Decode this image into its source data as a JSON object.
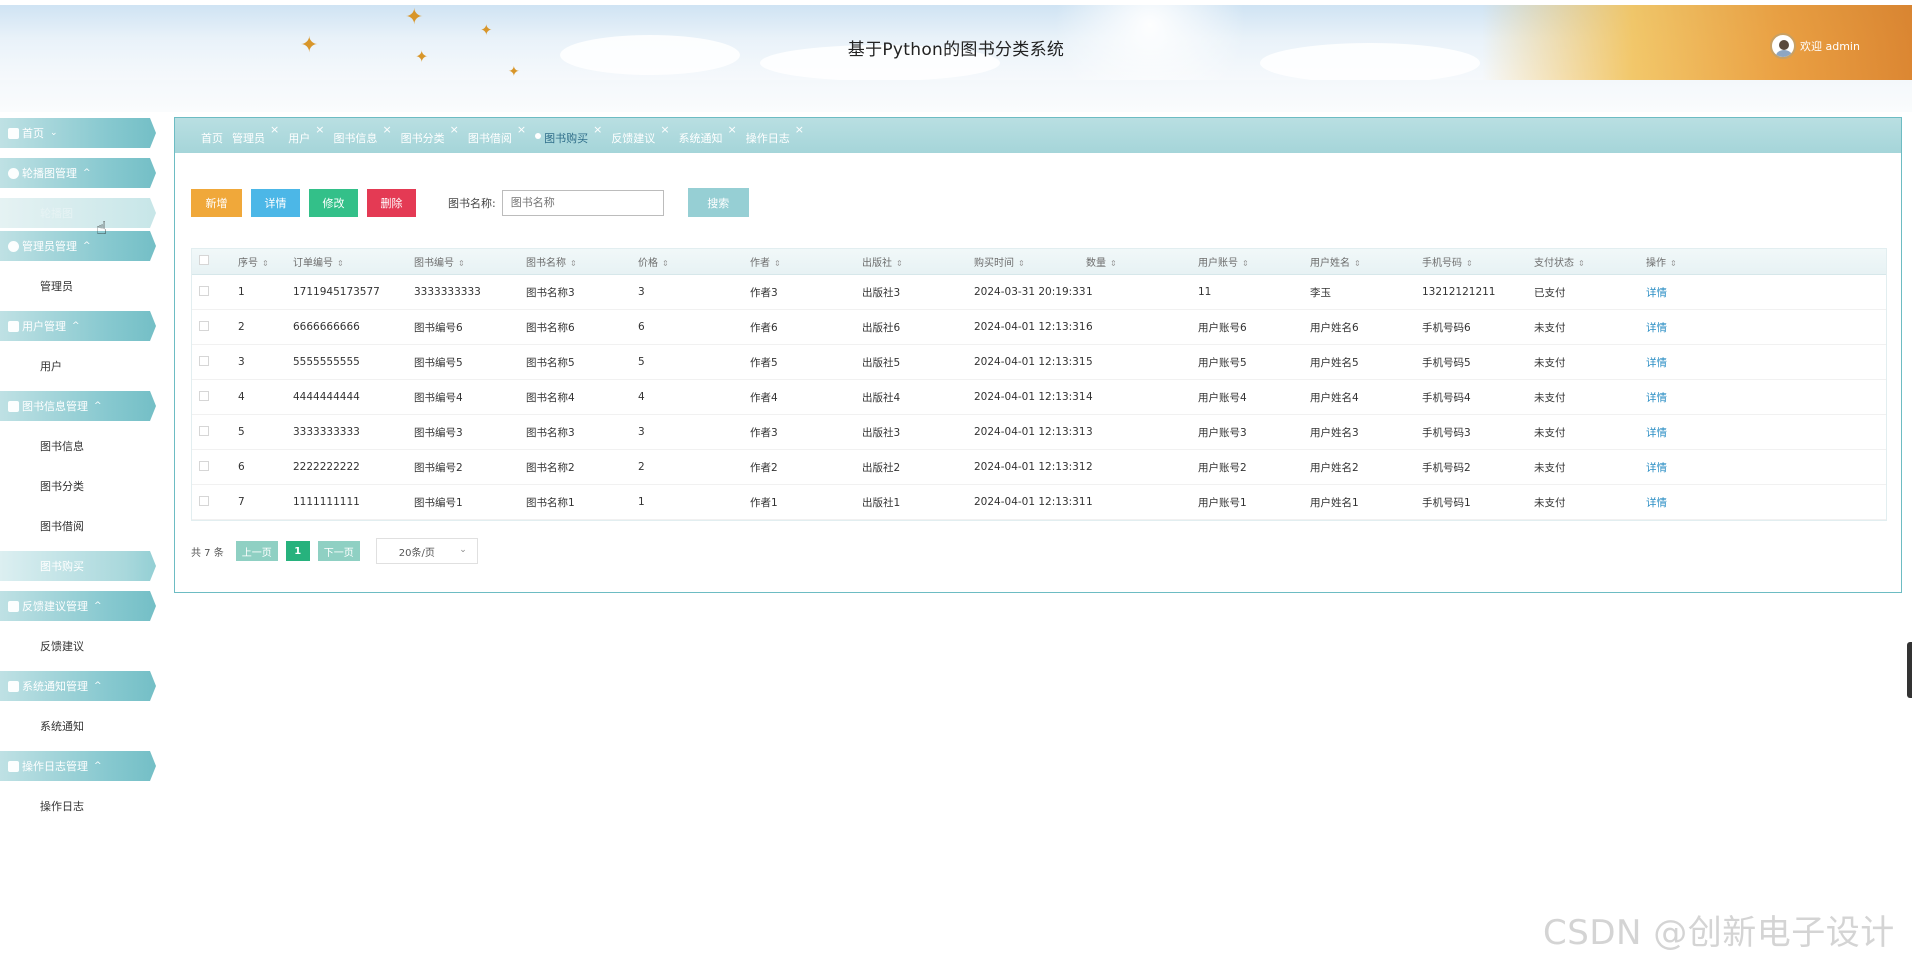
{
  "header": {
    "title": "基于Python的图书分类系统",
    "welcome": "欢迎 admin"
  },
  "sidebar": {
    "items": [
      {
        "type": "group",
        "label": "首页",
        "icon": "home-icon",
        "chevron": "⌄"
      },
      {
        "type": "group",
        "label": "轮播图管理",
        "icon": "carousel-icon",
        "chevron": "^"
      },
      {
        "type": "sub",
        "label": "轮播图",
        "state": "hover"
      },
      {
        "type": "group",
        "label": "管理员管理",
        "icon": "admin-icon",
        "chevron": "^"
      },
      {
        "type": "sub",
        "label": "管理员"
      },
      {
        "type": "group",
        "label": "用户管理",
        "icon": "user-icon",
        "chevron": "^"
      },
      {
        "type": "sub",
        "label": "用户"
      },
      {
        "type": "group",
        "label": "图书信息管理",
        "icon": "book-icon",
        "chevron": "^"
      },
      {
        "type": "sub",
        "label": "图书信息"
      },
      {
        "type": "sub",
        "label": "图书分类"
      },
      {
        "type": "sub",
        "label": "图书借阅"
      },
      {
        "type": "sub",
        "label": "图书购买",
        "state": "active"
      },
      {
        "type": "group",
        "label": "反馈建议管理",
        "icon": "feedback-icon",
        "chevron": "^"
      },
      {
        "type": "sub",
        "label": "反馈建议"
      },
      {
        "type": "group",
        "label": "系统通知管理",
        "icon": "notice-icon",
        "chevron": "^"
      },
      {
        "type": "sub",
        "label": "系统通知"
      },
      {
        "type": "group",
        "label": "操作日志管理",
        "icon": "log-icon",
        "chevron": "^"
      },
      {
        "type": "sub",
        "label": "操作日志"
      }
    ]
  },
  "tabs": [
    {
      "label": "首页",
      "closable": false
    },
    {
      "label": "管理员",
      "closable": true
    },
    {
      "label": "用户",
      "closable": true
    },
    {
      "label": "图书信息",
      "closable": true
    },
    {
      "label": "图书分类",
      "closable": true
    },
    {
      "label": "图书借阅",
      "closable": true
    },
    {
      "label": "图书购买",
      "closable": true,
      "active": true
    },
    {
      "label": "反馈建议",
      "closable": true
    },
    {
      "label": "系统通知",
      "closable": true
    },
    {
      "label": "操作日志",
      "closable": true
    }
  ],
  "toolbar": {
    "add_label": "新增",
    "detail_label": "详情",
    "edit_label": "修改",
    "delete_label": "删除",
    "search_label": "图书名称:",
    "search_placeholder": "图书名称",
    "search_button": "搜索"
  },
  "table": {
    "columns": [
      "序号",
      "订单编号",
      "图书编号",
      "图书名称",
      "价格",
      "作者",
      "出版社",
      "购买时间",
      "数量",
      "用户账号",
      "用户姓名",
      "手机号码",
      "支付状态",
      "操作"
    ],
    "rows": [
      [
        "1",
        "1711945173577",
        "3333333333",
        "图书名称3",
        "3",
        "作者3",
        "出版社3",
        "2024-03-31 20:19:33",
        "1",
        "11",
        "李玉",
        "13212121211",
        "已支付",
        "详情"
      ],
      [
        "2",
        "6666666666",
        "图书编号6",
        "图书名称6",
        "6",
        "作者6",
        "出版社6",
        "2024-04-01 12:13:31",
        "6",
        "用户账号6",
        "用户姓名6",
        "手机号码6",
        "未支付",
        "详情"
      ],
      [
        "3",
        "5555555555",
        "图书编号5",
        "图书名称5",
        "5",
        "作者5",
        "出版社5",
        "2024-04-01 12:13:31",
        "5",
        "用户账号5",
        "用户姓名5",
        "手机号码5",
        "未支付",
        "详情"
      ],
      [
        "4",
        "4444444444",
        "图书编号4",
        "图书名称4",
        "4",
        "作者4",
        "出版社4",
        "2024-04-01 12:13:31",
        "4",
        "用户账号4",
        "用户姓名4",
        "手机号码4",
        "未支付",
        "详情"
      ],
      [
        "5",
        "3333333333",
        "图书编号3",
        "图书名称3",
        "3",
        "作者3",
        "出版社3",
        "2024-04-01 12:13:31",
        "3",
        "用户账号3",
        "用户姓名3",
        "手机号码3",
        "未支付",
        "详情"
      ],
      [
        "6",
        "2222222222",
        "图书编号2",
        "图书名称2",
        "2",
        "作者2",
        "出版社2",
        "2024-04-01 12:13:31",
        "2",
        "用户账号2",
        "用户姓名2",
        "手机号码2",
        "未支付",
        "详情"
      ],
      [
        "7",
        "1111111111",
        "图书编号1",
        "图书名称1",
        "1",
        "作者1",
        "出版社1",
        "2024-04-01 12:13:31",
        "1",
        "用户账号1",
        "用户姓名1",
        "手机号码1",
        "未支付",
        "详情"
      ]
    ]
  },
  "pager": {
    "total": "共 7 条",
    "prev": "上一页",
    "current": "1",
    "next": "下一页",
    "page_size": "20条/页"
  },
  "watermark": "CSDN @创新电子设计",
  "colors": {
    "accent": "#86c8cf",
    "add": "#f0a83a",
    "detail": "#4cb7e7",
    "edit": "#33c089",
    "delete": "#e43a54"
  }
}
